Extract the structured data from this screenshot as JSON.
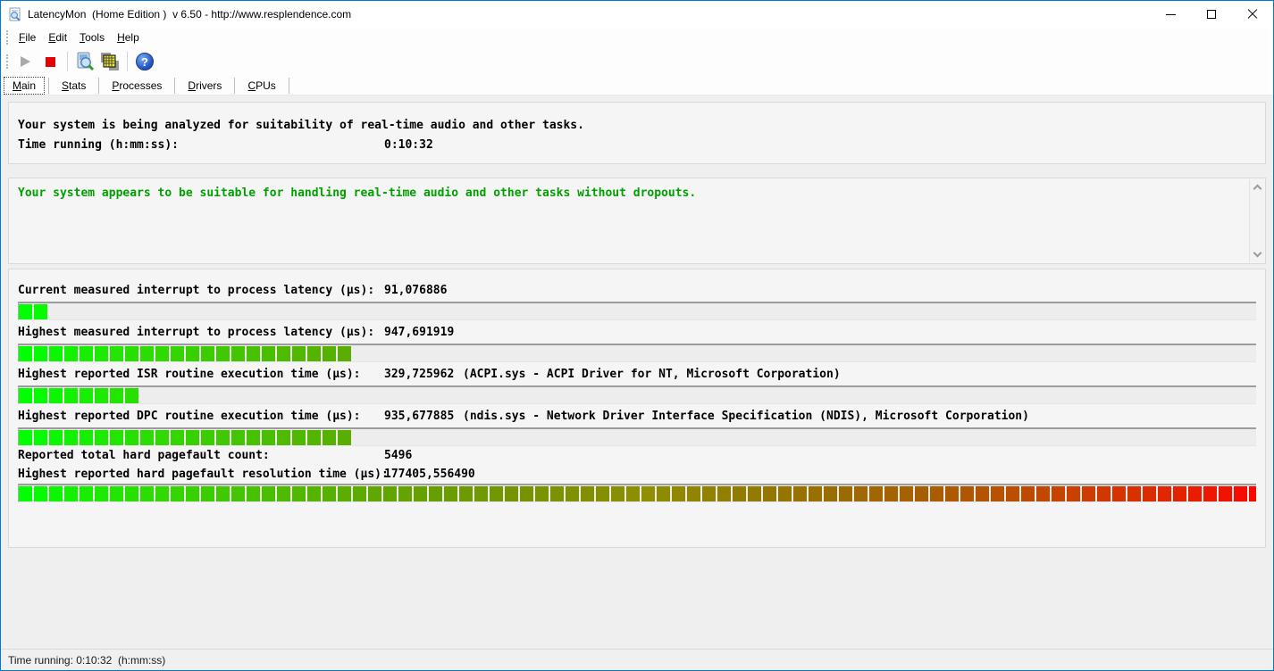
{
  "window": {
    "title": "LatencyMon  (Home Edition )  v 6.50 - http://www.resplendence.com",
    "border_color": "#0078d7",
    "controls": [
      {
        "name": "minimize"
      },
      {
        "name": "maximize"
      },
      {
        "name": "close"
      }
    ]
  },
  "menu": {
    "items": [
      {
        "label": "File"
      },
      {
        "label": "Edit"
      },
      {
        "label": "Tools"
      },
      {
        "label": "Help"
      }
    ]
  },
  "toolbar": {
    "icons": [
      {
        "name": "start-monitor-icon",
        "enabled": false
      },
      {
        "name": "stop-monitor-icon",
        "enabled": true
      },
      {
        "name": "analyze-options-icon",
        "enabled": true
      },
      {
        "name": "copy-report-icon",
        "enabled": true
      },
      {
        "name": "help-icon",
        "enabled": true
      }
    ],
    "help_glyph": "?",
    "stop_color": "#e60000"
  },
  "tabs": [
    {
      "label": "Main",
      "selected": true
    },
    {
      "label": "Stats",
      "selected": false
    },
    {
      "label": "Processes",
      "selected": false
    },
    {
      "label": "Drivers",
      "selected": false
    },
    {
      "label": "CPUs",
      "selected": false
    }
  ],
  "analysis_panel": {
    "status_line": "Your system is being analyzed for suitability of real-time audio and other tasks.",
    "time_label": "Time running (h:mm:ss):",
    "time_value": "0:10:32"
  },
  "message_panel": {
    "message": "Your system appears to be suitable for handling real-time audio and other tasks without dropouts.",
    "color": "#00a000"
  },
  "measurements": {
    "bar_total_segments": 83,
    "bar_color_model": {
      "hue_start": 120,
      "hue_end": 0,
      "lightness_base": 50,
      "lightness_dip": 22
    },
    "rows": [
      {
        "label": "Current measured interrupt to process latency (µs):",
        "value": "91,076886",
        "extra": "",
        "bar_segments": 2,
        "compact": false
      },
      {
        "label": "Highest measured interrupt to process latency (µs):",
        "value": "947,691919",
        "extra": "",
        "bar_segments": 22,
        "compact": false
      },
      {
        "label": "Highest reported ISR routine execution time (µs):",
        "value": "329,725962",
        "extra": "(ACPI.sys - ACPI Driver for NT, Microsoft Corporation)",
        "bar_segments": 8,
        "compact": false
      },
      {
        "label": "Highest reported DPC routine execution time (µs):",
        "value": "935,677885",
        "extra": "(ndis.sys - Network Driver Interface Specification (NDIS), Microsoft Corporation)",
        "bar_segments": 22,
        "compact": false
      },
      {
        "label": "Reported total hard pagefault count:",
        "value": "5496",
        "extra": "",
        "bar_segments": null,
        "compact": true
      },
      {
        "label": "Highest reported hard pagefault resolution time (µs):",
        "value": "177405,556490",
        "extra": "",
        "bar_segments": 83,
        "compact": true
      }
    ]
  },
  "status_bar": {
    "text": "Time running: 0:10:32  (h:mm:ss)"
  }
}
